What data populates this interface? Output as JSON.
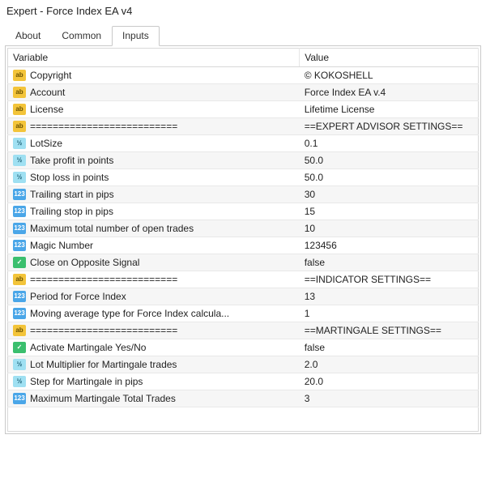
{
  "window": {
    "title": "Expert - Force Index EA v4"
  },
  "tabs": {
    "about": "About",
    "common": "Common",
    "inputs": "Inputs"
  },
  "headers": {
    "variable": "Variable",
    "value": "Value"
  },
  "iconLabels": {
    "ab": "ab",
    "vz": "½",
    "123": "123",
    "bool": "✓"
  },
  "rows": [
    {
      "icon": "ab",
      "variable": "Copyright",
      "value": "© KOKOSHELL"
    },
    {
      "icon": "ab",
      "variable": "Account",
      "value": "Force Index EA v.4"
    },
    {
      "icon": "ab",
      "variable": "License",
      "value": "Lifetime License"
    },
    {
      "icon": "ab",
      "variable": "==========================",
      "value": "==EXPERT ADVISOR SETTINGS=="
    },
    {
      "icon": "vz",
      "variable": "LotSize",
      "value": "0.1"
    },
    {
      "icon": "vz",
      "variable": "Take profit in points",
      "value": "50.0"
    },
    {
      "icon": "vz",
      "variable": "Stop loss in points",
      "value": "50.0"
    },
    {
      "icon": "123",
      "variable": "Trailing start in pips",
      "value": "30"
    },
    {
      "icon": "123",
      "variable": "Trailing stop in pips",
      "value": "15"
    },
    {
      "icon": "123",
      "variable": "Maximum total number of open trades",
      "value": "10"
    },
    {
      "icon": "123",
      "variable": "Magic Number",
      "value": "123456"
    },
    {
      "icon": "bool",
      "variable": "Close on Opposite Signal",
      "value": "false"
    },
    {
      "icon": "ab",
      "variable": "==========================",
      "value": "==INDICATOR SETTINGS=="
    },
    {
      "icon": "123",
      "variable": "Period for Force Index",
      "value": "13"
    },
    {
      "icon": "123",
      "variable": "Moving average type for Force Index calcula...",
      "value": "1"
    },
    {
      "icon": "ab",
      "variable": "==========================",
      "value": "==MARTINGALE SETTINGS=="
    },
    {
      "icon": "bool",
      "variable": "Activate Martingale Yes/No",
      "value": "false"
    },
    {
      "icon": "vz",
      "variable": "Lot Multiplier for Martingale trades",
      "value": "2.0"
    },
    {
      "icon": "vz",
      "variable": "Step for Martingale in pips",
      "value": "20.0"
    },
    {
      "icon": "123",
      "variable": "Maximum Martingale Total Trades",
      "value": "3"
    }
  ]
}
